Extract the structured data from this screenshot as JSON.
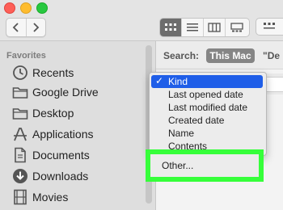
{
  "toolbar": {
    "back_icon": "chevron-left-icon",
    "forward_icon": "chevron-right-icon",
    "views": [
      "icon-view-icon",
      "list-view-icon",
      "column-view-icon",
      "gallery-view-icon"
    ],
    "active_view": "icon-view-icon",
    "group_icon": "group-by-icon"
  },
  "sidebar": {
    "heading": "Favorites",
    "items": [
      {
        "label": "Recents",
        "icon": "clock-icon"
      },
      {
        "label": "Google Drive",
        "icon": "folder-icon"
      },
      {
        "label": "Desktop",
        "icon": "folder-icon"
      },
      {
        "label": "Applications",
        "icon": "applications-icon"
      },
      {
        "label": "Documents",
        "icon": "document-icon"
      },
      {
        "label": "Downloads",
        "icon": "download-icon"
      },
      {
        "label": "Movies",
        "icon": "film-icon"
      }
    ]
  },
  "search": {
    "label": "Search:",
    "scope_selected": "This Mac",
    "scope_other": "\"De"
  },
  "dropdown": {
    "items": [
      {
        "label": "Kind",
        "checked": true
      },
      {
        "label": "Last opened date",
        "checked": false
      },
      {
        "label": "Last modified date",
        "checked": false
      },
      {
        "label": "Created date",
        "checked": false
      },
      {
        "label": "Name",
        "checked": false
      },
      {
        "label": "Contents",
        "checked": false
      }
    ],
    "other_label": "Other...",
    "selected_color": "#1f5ee8",
    "highlight_color": "#36ff3a"
  }
}
